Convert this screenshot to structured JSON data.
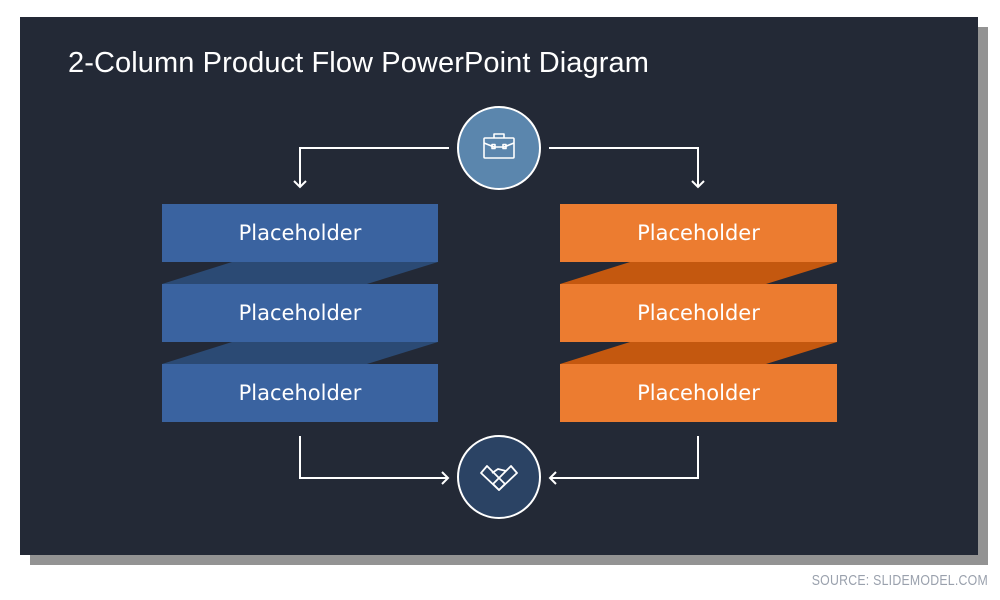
{
  "slide": {
    "title": "2-Column Product Flow PowerPoint Diagram",
    "background_color": "#232936"
  },
  "top_node": {
    "icon": "briefcase-icon",
    "fill": "#5b86ad"
  },
  "bottom_node": {
    "icon": "handshake-icon",
    "fill": "#2b4364"
  },
  "columns": [
    {
      "name": "left",
      "color": "#3a63a0",
      "fold_color": "#2b4a74",
      "items": [
        {
          "label": "Placeholder"
        },
        {
          "label": "Placeholder"
        },
        {
          "label": "Placeholder"
        }
      ]
    },
    {
      "name": "right",
      "color": "#ec7c30",
      "fold_color": "#c4580f",
      "items": [
        {
          "label": "Placeholder"
        },
        {
          "label": "Placeholder"
        },
        {
          "label": "Placeholder"
        }
      ]
    }
  ],
  "source": "SOURCE: SLIDEMODEL.COM"
}
